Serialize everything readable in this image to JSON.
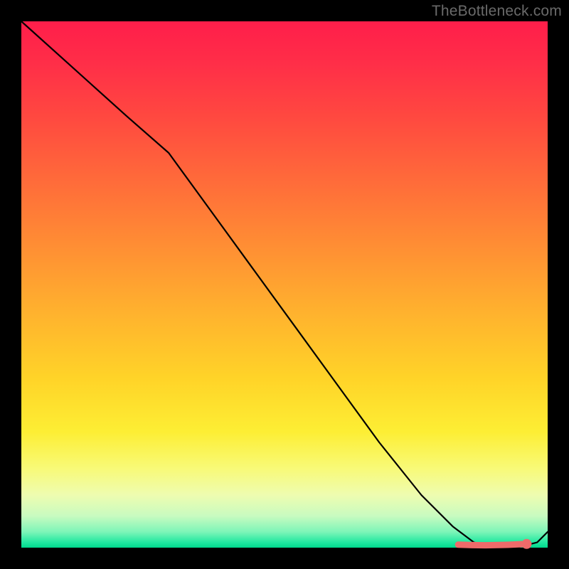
{
  "watermark": "TheBottleneck.com",
  "chart_data": {
    "type": "line",
    "title": "",
    "xlabel": "",
    "ylabel": "",
    "xlim": [
      0,
      100
    ],
    "ylim": [
      0,
      100
    ],
    "series": [
      {
        "name": "bottleneck-curve",
        "x": [
          0,
          10,
          20,
          28,
          36,
          44,
          52,
          60,
          68,
          76,
          82,
          86,
          90,
          94,
          98,
          100
        ],
        "y": [
          100,
          91,
          82,
          75,
          64,
          53,
          42,
          31,
          20,
          10,
          4,
          1,
          0,
          0,
          1,
          3
        ]
      }
    ],
    "optimal_range": {
      "x_start": 83,
      "x_end": 96,
      "y": 0.7
    },
    "optimal_point": {
      "x": 96,
      "y": 0.7
    },
    "dash_pattern_x": [
      84.5,
      86.0,
      87.0,
      88.5,
      89.3,
      90.3,
      91.8,
      93.0,
      94.5,
      95.5
    ],
    "colors": {
      "curve": "#000000",
      "optimal": "#ef6a6a",
      "gradient_top": "#ff1e4a",
      "gradient_mid": "#ffd428",
      "gradient_bottom": "#00d88c"
    }
  }
}
